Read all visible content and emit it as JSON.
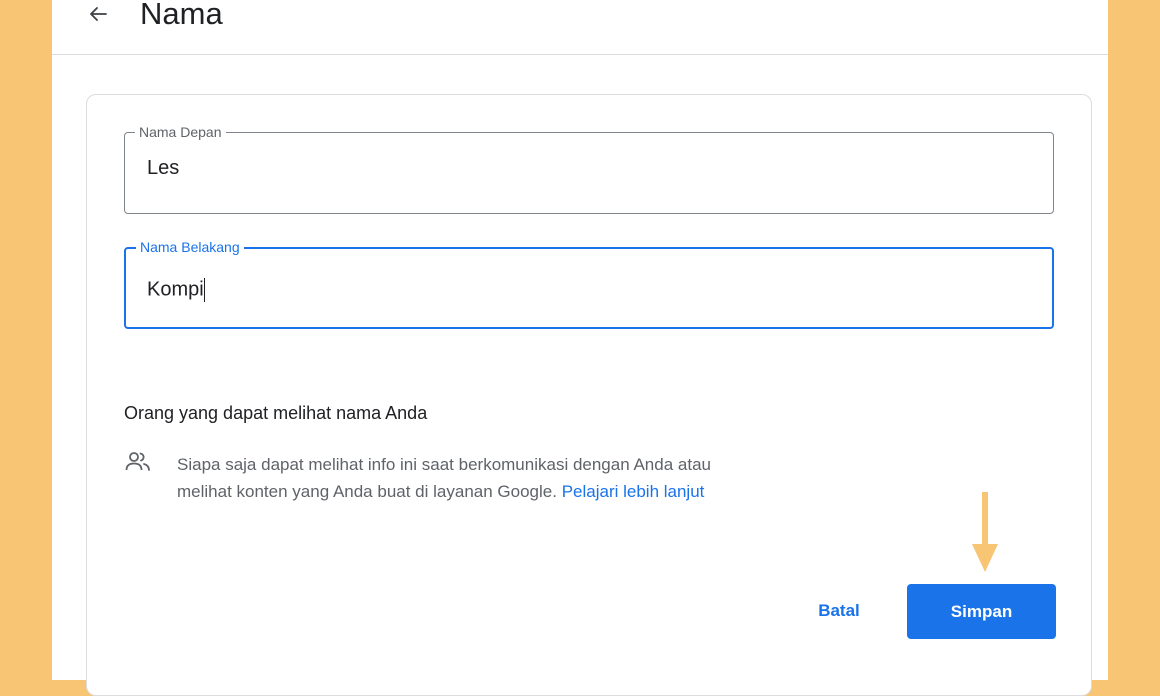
{
  "header": {
    "title": "Nama",
    "back_icon": "arrow-back-icon"
  },
  "form": {
    "first_name": {
      "label": "Nama Depan",
      "value": "Les"
    },
    "last_name": {
      "label": "Nama Belakang",
      "value": "Kompi"
    }
  },
  "visibility": {
    "title": "Orang yang dapat melihat nama Anda",
    "icon": "people-icon",
    "text": "Siapa saja dapat melihat info ini saat berkomunikasi dengan Anda atau melihat konten yang Anda buat di layanan Google.",
    "link": "Pelajari lebih lanjut"
  },
  "actions": {
    "cancel_label": "Batal",
    "save_label": "Simpan"
  },
  "annotation": {
    "arrow_icon": "arrow-down-icon",
    "color": "#f7c574"
  },
  "colors": {
    "accent": "#1a73e8",
    "background": "#f7c574"
  }
}
